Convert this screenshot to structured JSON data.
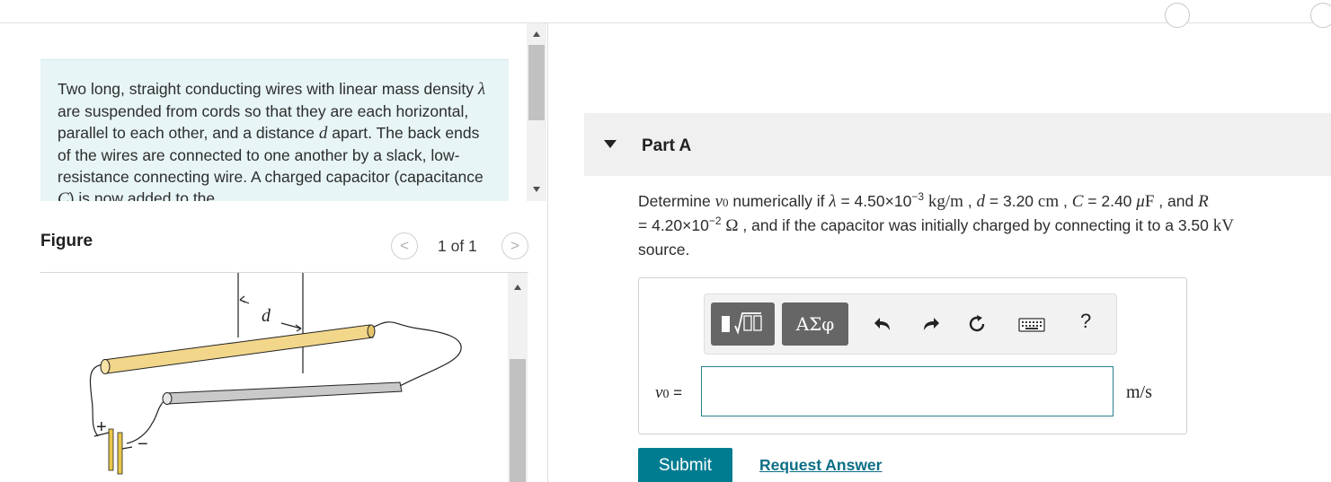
{
  "problem": {
    "text_segments": [
      "Two long, straight conducting wires with linear mass density ",
      "λ",
      " are suspended from cords so that they are each horizontal, parallel to each other, and a distance ",
      "d",
      " apart. The back ends of the wires are connected to one another by a slack, low-resistance connecting wire. A charged capacitor (capacitance ",
      "C",
      ") is now added to the"
    ]
  },
  "figure": {
    "title": "Figure",
    "counter": "1 of 1",
    "prev_icon": "<",
    "next_icon": ">",
    "distance_label": "d",
    "plus_label": "+",
    "minus_label": "−",
    "wire_color_top": "#f2d68a",
    "wire_color_bottom": "#c9c9c9",
    "capacitor_color": "#e8c84a"
  },
  "part": {
    "label": "Part A",
    "collapse_icon": "triangle-down-icon"
  },
  "question": {
    "p1": "Determine ",
    "v0": "v",
    "v0_sub": "0",
    "p2": " numerically if ",
    "lambda": "λ",
    "p3": " = 4.50×10",
    "exp1": "−3",
    "unit1": "kg/m",
    "p4": " , ",
    "d": "d",
    "p5": " = 3.20 ",
    "unit2": "cm",
    "p6": " , ",
    "C": "C",
    "p7": " = 2.40 ",
    "mu": "μ",
    "unit3": "F",
    "p8": " , and ",
    "R": "R",
    "p9": " = 4.20×10",
    "exp2": "−2",
    "ohm": "Ω",
    "p10": " , and if the capacitor was initially charged by connecting it to a 3.50 ",
    "unit4": "kV",
    "p11": " source."
  },
  "answer": {
    "greek_button": "ΑΣφ",
    "help_button": "?",
    "var_label": "v",
    "var_sub": "0",
    "equals": " =",
    "input_value": "",
    "unit": "m/s"
  },
  "actions": {
    "submit": "Submit",
    "request": "Request Answer"
  },
  "colors": {
    "accent": "#007c91",
    "link": "#0d6f86",
    "problem_bg": "#e7f5f6"
  }
}
